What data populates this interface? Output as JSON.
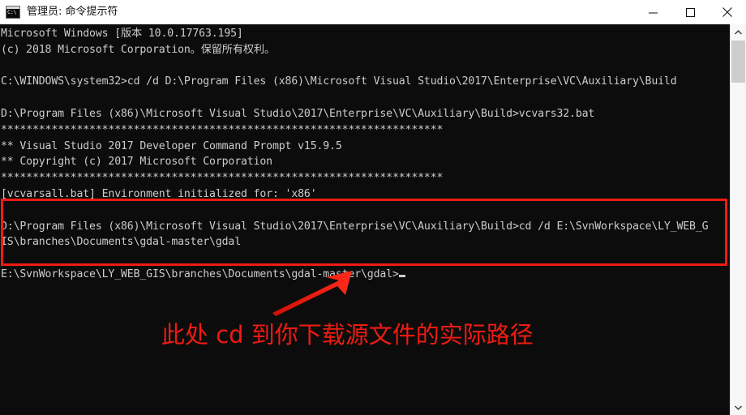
{
  "window": {
    "title": "管理员: 命令提示符",
    "icon_name": "cmd-icon",
    "icon_glyph": "C:\\",
    "minimize_label": "最小化",
    "maximize_label": "最大化",
    "close_label": "关闭"
  },
  "console": {
    "background": "#0c0c0c",
    "foreground": "#cccccc",
    "lines": [
      "Microsoft Windows [版本 10.0.17763.195]",
      "(c) 2018 Microsoft Corporation。保留所有权利。",
      "",
      "C:\\WINDOWS\\system32>cd /d D:\\Program Files (x86)\\Microsoft Visual Studio\\2017\\Enterprise\\VC\\Auxiliary\\Build",
      "",
      "D:\\Program Files (x86)\\Microsoft Visual Studio\\2017\\Enterprise\\VC\\Auxiliary\\Build>vcvars32.bat",
      "**********************************************************************",
      "** Visual Studio 2017 Developer Command Prompt v15.9.5",
      "** Copyright (c) 2017 Microsoft Corporation",
      "**********************************************************************",
      "[vcvarsall.bat] Environment initialized for: 'x86'",
      "",
      "D:\\Program Files (x86)\\Microsoft Visual Studio\\2017\\Enterprise\\VC\\Auxiliary\\Build>cd /d E:\\SvnWorkspace\\LY_WEB_G",
      "IS\\branches\\Documents\\gdal-master\\gdal",
      "",
      "E:\\SvnWorkspace\\LY_WEB_GIS\\branches\\Documents\\gdal-master\\gdal>"
    ]
  },
  "annotations": {
    "color": "#ee1b12",
    "text": "此处 cd 到你下载源文件的实际路径",
    "highlight_box_label": "红框标注区域",
    "arrow_label": "红色箭头"
  },
  "scrollbar": {
    "up_arrow": "▲",
    "down_arrow": "▼",
    "thumb_label": "滚动条滑块"
  }
}
